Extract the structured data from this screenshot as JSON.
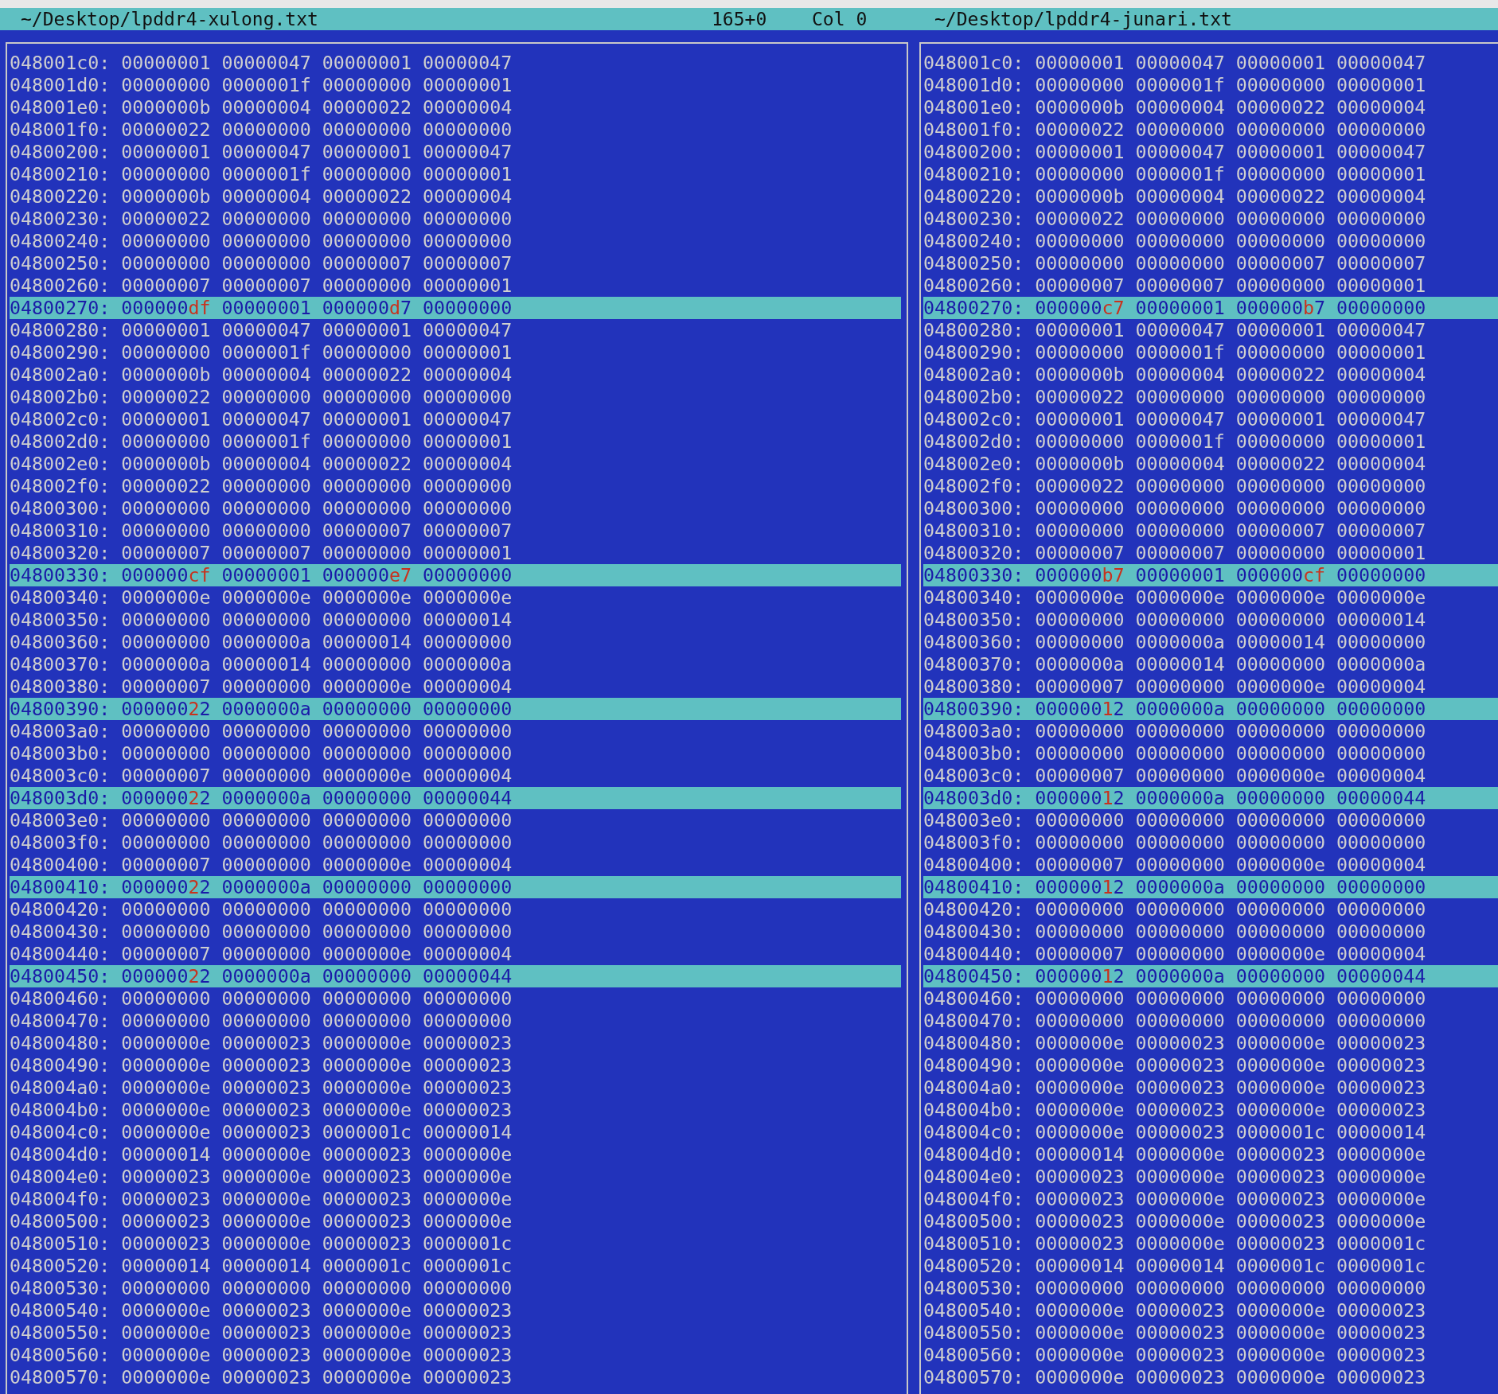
{
  "title_bar": {
    "left_file": "~/Desktop/lpddr4-xulong.txt",
    "position": "165+0",
    "column": "Col 0",
    "right_file": "~/Desktop/lpddr4-junari.txt"
  },
  "panels": [
    {
      "rows": [
        {
          "addr": "048001c0:",
          "words": [
            "00000001",
            "00000047",
            "00000001",
            "00000047"
          ],
          "highlighted": false
        },
        {
          "addr": "048001d0:",
          "words": [
            "00000000",
            "0000001f",
            "00000000",
            "00000001"
          ],
          "highlighted": false
        },
        {
          "addr": "048001e0:",
          "words": [
            "0000000b",
            "00000004",
            "00000022",
            "00000004"
          ],
          "highlighted": false
        },
        {
          "addr": "048001f0:",
          "words": [
            "00000022",
            "00000000",
            "00000000",
            "00000000"
          ],
          "highlighted": false
        },
        {
          "addr": "04800200:",
          "words": [
            "00000001",
            "00000047",
            "00000001",
            "00000047"
          ],
          "highlighted": false
        },
        {
          "addr": "04800210:",
          "words": [
            "00000000",
            "0000001f",
            "00000000",
            "00000001"
          ],
          "highlighted": false
        },
        {
          "addr": "04800220:",
          "words": [
            "0000000b",
            "00000004",
            "00000022",
            "00000004"
          ],
          "highlighted": false
        },
        {
          "addr": "04800230:",
          "words": [
            "00000022",
            "00000000",
            "00000000",
            "00000000"
          ],
          "highlighted": false
        },
        {
          "addr": "04800240:",
          "words": [
            "00000000",
            "00000000",
            "00000000",
            "00000000"
          ],
          "highlighted": false
        },
        {
          "addr": "04800250:",
          "words": [
            "00000000",
            "00000000",
            "00000007",
            "00000007"
          ],
          "highlighted": false
        },
        {
          "addr": "04800260:",
          "words": [
            "00000007",
            "00000007",
            "00000000",
            "00000001"
          ],
          "highlighted": false
        },
        {
          "addr": "04800270:",
          "words": [
            {
              "same": "000000",
              "diff": "df"
            },
            "00000001",
            {
              "same": "000000",
              "diff": "d",
              "rest": "7"
            },
            "00000000"
          ],
          "highlighted": true
        },
        {
          "addr": "04800280:",
          "words": [
            "00000001",
            "00000047",
            "00000001",
            "00000047"
          ],
          "highlighted": false
        },
        {
          "addr": "04800290:",
          "words": [
            "00000000",
            "0000001f",
            "00000000",
            "00000001"
          ],
          "highlighted": false
        },
        {
          "addr": "048002a0:",
          "words": [
            "0000000b",
            "00000004",
            "00000022",
            "00000004"
          ],
          "highlighted": false
        },
        {
          "addr": "048002b0:",
          "words": [
            "00000022",
            "00000000",
            "00000000",
            "00000000"
          ],
          "highlighted": false
        },
        {
          "addr": "048002c0:",
          "words": [
            "00000001",
            "00000047",
            "00000001",
            "00000047"
          ],
          "highlighted": false
        },
        {
          "addr": "048002d0:",
          "words": [
            "00000000",
            "0000001f",
            "00000000",
            "00000001"
          ],
          "highlighted": false
        },
        {
          "addr": "048002e0:",
          "words": [
            "0000000b",
            "00000004",
            "00000022",
            "00000004"
          ],
          "highlighted": false
        },
        {
          "addr": "048002f0:",
          "words": [
            "00000022",
            "00000000",
            "00000000",
            "00000000"
          ],
          "highlighted": false
        },
        {
          "addr": "04800300:",
          "words": [
            "00000000",
            "00000000",
            "00000000",
            "00000000"
          ],
          "highlighted": false
        },
        {
          "addr": "04800310:",
          "words": [
            "00000000",
            "00000000",
            "00000007",
            "00000007"
          ],
          "highlighted": false
        },
        {
          "addr": "04800320:",
          "words": [
            "00000007",
            "00000007",
            "00000000",
            "00000001"
          ],
          "highlighted": false
        },
        {
          "addr": "04800330:",
          "words": [
            {
              "same": "000000",
              "diff": "cf"
            },
            "00000001",
            {
              "same": "000000",
              "diff": "e7"
            },
            "00000000"
          ],
          "highlighted": true
        },
        {
          "addr": "04800340:",
          "words": [
            "0000000e",
            "0000000e",
            "0000000e",
            "0000000e"
          ],
          "highlighted": false
        },
        {
          "addr": "04800350:",
          "words": [
            "00000000",
            "00000000",
            "00000000",
            "00000014"
          ],
          "highlighted": false
        },
        {
          "addr": "04800360:",
          "words": [
            "00000000",
            "0000000a",
            "00000014",
            "00000000"
          ],
          "highlighted": false
        },
        {
          "addr": "04800370:",
          "words": [
            "0000000a",
            "00000014",
            "00000000",
            "0000000a"
          ],
          "highlighted": false
        },
        {
          "addr": "04800380:",
          "words": [
            "00000007",
            "00000000",
            "0000000e",
            "00000004"
          ],
          "highlighted": false
        },
        {
          "addr": "04800390:",
          "words": [
            {
              "same": "000000",
              "diff": "2",
              "rest": "2"
            },
            "0000000a",
            "00000000",
            "00000000"
          ],
          "highlighted": true
        },
        {
          "addr": "048003a0:",
          "words": [
            "00000000",
            "00000000",
            "00000000",
            "00000000"
          ],
          "highlighted": false
        },
        {
          "addr": "048003b0:",
          "words": [
            "00000000",
            "00000000",
            "00000000",
            "00000000"
          ],
          "highlighted": false
        },
        {
          "addr": "048003c0:",
          "words": [
            "00000007",
            "00000000",
            "0000000e",
            "00000004"
          ],
          "highlighted": false
        },
        {
          "addr": "048003d0:",
          "words": [
            {
              "same": "000000",
              "diff": "2",
              "rest": "2"
            },
            "0000000a",
            "00000000",
            "00000044"
          ],
          "highlighted": true
        },
        {
          "addr": "048003e0:",
          "words": [
            "00000000",
            "00000000",
            "00000000",
            "00000000"
          ],
          "highlighted": false
        },
        {
          "addr": "048003f0:",
          "words": [
            "00000000",
            "00000000",
            "00000000",
            "00000000"
          ],
          "highlighted": false
        },
        {
          "addr": "04800400:",
          "words": [
            "00000007",
            "00000000",
            "0000000e",
            "00000004"
          ],
          "highlighted": false
        },
        {
          "addr": "04800410:",
          "words": [
            {
              "same": "000000",
              "diff": "2",
              "rest": "2"
            },
            "0000000a",
            "00000000",
            "00000000"
          ],
          "highlighted": true
        },
        {
          "addr": "04800420:",
          "words": [
            "00000000",
            "00000000",
            "00000000",
            "00000000"
          ],
          "highlighted": false
        },
        {
          "addr": "04800430:",
          "words": [
            "00000000",
            "00000000",
            "00000000",
            "00000000"
          ],
          "highlighted": false
        },
        {
          "addr": "04800440:",
          "words": [
            "00000007",
            "00000000",
            "0000000e",
            "00000004"
          ],
          "highlighted": false
        },
        {
          "addr": "04800450:",
          "words": [
            {
              "same": "000000",
              "diff": "2",
              "rest": "2"
            },
            "0000000a",
            "00000000",
            "00000044"
          ],
          "highlighted": true
        },
        {
          "addr": "04800460:",
          "words": [
            "00000000",
            "00000000",
            "00000000",
            "00000000"
          ],
          "highlighted": false
        },
        {
          "addr": "04800470:",
          "words": [
            "00000000",
            "00000000",
            "00000000",
            "00000000"
          ],
          "highlighted": false
        },
        {
          "addr": "04800480:",
          "words": [
            "0000000e",
            "00000023",
            "0000000e",
            "00000023"
          ],
          "highlighted": false
        },
        {
          "addr": "04800490:",
          "words": [
            "0000000e",
            "00000023",
            "0000000e",
            "00000023"
          ],
          "highlighted": false
        },
        {
          "addr": "048004a0:",
          "words": [
            "0000000e",
            "00000023",
            "0000000e",
            "00000023"
          ],
          "highlighted": false
        },
        {
          "addr": "048004b0:",
          "words": [
            "0000000e",
            "00000023",
            "0000000e",
            "00000023"
          ],
          "highlighted": false
        },
        {
          "addr": "048004c0:",
          "words": [
            "0000000e",
            "00000023",
            "0000001c",
            "00000014"
          ],
          "highlighted": false
        },
        {
          "addr": "048004d0:",
          "words": [
            "00000014",
            "0000000e",
            "00000023",
            "0000000e"
          ],
          "highlighted": false
        },
        {
          "addr": "048004e0:",
          "words": [
            "00000023",
            "0000000e",
            "00000023",
            "0000000e"
          ],
          "highlighted": false
        },
        {
          "addr": "048004f0:",
          "words": [
            "00000023",
            "0000000e",
            "00000023",
            "0000000e"
          ],
          "highlighted": false
        },
        {
          "addr": "04800500:",
          "words": [
            "00000023",
            "0000000e",
            "00000023",
            "0000000e"
          ],
          "highlighted": false
        },
        {
          "addr": "04800510:",
          "words": [
            "00000023",
            "0000000e",
            "00000023",
            "0000001c"
          ],
          "highlighted": false
        },
        {
          "addr": "04800520:",
          "words": [
            "00000014",
            "00000014",
            "0000001c",
            "0000001c"
          ],
          "highlighted": false
        },
        {
          "addr": "04800530:",
          "words": [
            "00000000",
            "00000000",
            "00000000",
            "00000000"
          ],
          "highlighted": false
        },
        {
          "addr": "04800540:",
          "words": [
            "0000000e",
            "00000023",
            "0000000e",
            "00000023"
          ],
          "highlighted": false
        },
        {
          "addr": "04800550:",
          "words": [
            "0000000e",
            "00000023",
            "0000000e",
            "00000023"
          ],
          "highlighted": false
        },
        {
          "addr": "04800560:",
          "words": [
            "0000000e",
            "00000023",
            "0000000e",
            "00000023"
          ],
          "highlighted": false
        },
        {
          "addr": "04800570:",
          "words": [
            "0000000e",
            "00000023",
            "0000000e",
            "00000023"
          ],
          "highlighted": false
        }
      ]
    },
    {
      "rows": [
        {
          "addr": "048001c0:",
          "words": [
            "00000001",
            "00000047",
            "00000001",
            "00000047"
          ],
          "highlighted": false
        },
        {
          "addr": "048001d0:",
          "words": [
            "00000000",
            "0000001f",
            "00000000",
            "00000001"
          ],
          "highlighted": false
        },
        {
          "addr": "048001e0:",
          "words": [
            "0000000b",
            "00000004",
            "00000022",
            "00000004"
          ],
          "highlighted": false
        },
        {
          "addr": "048001f0:",
          "words": [
            "00000022",
            "00000000",
            "00000000",
            "00000000"
          ],
          "highlighted": false
        },
        {
          "addr": "04800200:",
          "words": [
            "00000001",
            "00000047",
            "00000001",
            "00000047"
          ],
          "highlighted": false
        },
        {
          "addr": "04800210:",
          "words": [
            "00000000",
            "0000001f",
            "00000000",
            "00000001"
          ],
          "highlighted": false
        },
        {
          "addr": "04800220:",
          "words": [
            "0000000b",
            "00000004",
            "00000022",
            "00000004"
          ],
          "highlighted": false
        },
        {
          "addr": "04800230:",
          "words": [
            "00000022",
            "00000000",
            "00000000",
            "00000000"
          ],
          "highlighted": false
        },
        {
          "addr": "04800240:",
          "words": [
            "00000000",
            "00000000",
            "00000000",
            "00000000"
          ],
          "highlighted": false
        },
        {
          "addr": "04800250:",
          "words": [
            "00000000",
            "00000000",
            "00000007",
            "00000007"
          ],
          "highlighted": false
        },
        {
          "addr": "04800260:",
          "words": [
            "00000007",
            "00000007",
            "00000000",
            "00000001"
          ],
          "highlighted": false
        },
        {
          "addr": "04800270:",
          "words": [
            {
              "same": "000000",
              "diff": "c7"
            },
            "00000001",
            {
              "same": "000000",
              "diff": "b",
              "rest": "7"
            },
            "00000000"
          ],
          "highlighted": true
        },
        {
          "addr": "04800280:",
          "words": [
            "00000001",
            "00000047",
            "00000001",
            "00000047"
          ],
          "highlighted": false
        },
        {
          "addr": "04800290:",
          "words": [
            "00000000",
            "0000001f",
            "00000000",
            "00000001"
          ],
          "highlighted": false
        },
        {
          "addr": "048002a0:",
          "words": [
            "0000000b",
            "00000004",
            "00000022",
            "00000004"
          ],
          "highlighted": false
        },
        {
          "addr": "048002b0:",
          "words": [
            "00000022",
            "00000000",
            "00000000",
            "00000000"
          ],
          "highlighted": false
        },
        {
          "addr": "048002c0:",
          "words": [
            "00000001",
            "00000047",
            "00000001",
            "00000047"
          ],
          "highlighted": false
        },
        {
          "addr": "048002d0:",
          "words": [
            "00000000",
            "0000001f",
            "00000000",
            "00000001"
          ],
          "highlighted": false
        },
        {
          "addr": "048002e0:",
          "words": [
            "0000000b",
            "00000004",
            "00000022",
            "00000004"
          ],
          "highlighted": false
        },
        {
          "addr": "048002f0:",
          "words": [
            "00000022",
            "00000000",
            "00000000",
            "00000000"
          ],
          "highlighted": false
        },
        {
          "addr": "04800300:",
          "words": [
            "00000000",
            "00000000",
            "00000000",
            "00000000"
          ],
          "highlighted": false
        },
        {
          "addr": "04800310:",
          "words": [
            "00000000",
            "00000000",
            "00000007",
            "00000007"
          ],
          "highlighted": false
        },
        {
          "addr": "04800320:",
          "words": [
            "00000007",
            "00000007",
            "00000000",
            "00000001"
          ],
          "highlighted": false
        },
        {
          "addr": "04800330:",
          "words": [
            {
              "same": "000000",
              "diff": "b7"
            },
            "00000001",
            {
              "same": "000000",
              "diff": "cf"
            },
            "00000000"
          ],
          "highlighted": true
        },
        {
          "addr": "04800340:",
          "words": [
            "0000000e",
            "0000000e",
            "0000000e",
            "0000000e"
          ],
          "highlighted": false
        },
        {
          "addr": "04800350:",
          "words": [
            "00000000",
            "00000000",
            "00000000",
            "00000014"
          ],
          "highlighted": false
        },
        {
          "addr": "04800360:",
          "words": [
            "00000000",
            "0000000a",
            "00000014",
            "00000000"
          ],
          "highlighted": false
        },
        {
          "addr": "04800370:",
          "words": [
            "0000000a",
            "00000014",
            "00000000",
            "0000000a"
          ],
          "highlighted": false
        },
        {
          "addr": "04800380:",
          "words": [
            "00000007",
            "00000000",
            "0000000e",
            "00000004"
          ],
          "highlighted": false
        },
        {
          "addr": "04800390:",
          "words": [
            {
              "same": "000000",
              "diff": "1",
              "rest": "2"
            },
            "0000000a",
            "00000000",
            "00000000"
          ],
          "highlighted": true
        },
        {
          "addr": "048003a0:",
          "words": [
            "00000000",
            "00000000",
            "00000000",
            "00000000"
          ],
          "highlighted": false
        },
        {
          "addr": "048003b0:",
          "words": [
            "00000000",
            "00000000",
            "00000000",
            "00000000"
          ],
          "highlighted": false
        },
        {
          "addr": "048003c0:",
          "words": [
            "00000007",
            "00000000",
            "0000000e",
            "00000004"
          ],
          "highlighted": false
        },
        {
          "addr": "048003d0:",
          "words": [
            {
              "same": "000000",
              "diff": "1",
              "rest": "2"
            },
            "0000000a",
            "00000000",
            "00000044"
          ],
          "highlighted": true
        },
        {
          "addr": "048003e0:",
          "words": [
            "00000000",
            "00000000",
            "00000000",
            "00000000"
          ],
          "highlighted": false
        },
        {
          "addr": "048003f0:",
          "words": [
            "00000000",
            "00000000",
            "00000000",
            "00000000"
          ],
          "highlighted": false
        },
        {
          "addr": "04800400:",
          "words": [
            "00000007",
            "00000000",
            "0000000e",
            "00000004"
          ],
          "highlighted": false
        },
        {
          "addr": "04800410:",
          "words": [
            {
              "same": "000000",
              "diff": "1",
              "rest": "2"
            },
            "0000000a",
            "00000000",
            "00000000"
          ],
          "highlighted": true
        },
        {
          "addr": "04800420:",
          "words": [
            "00000000",
            "00000000",
            "00000000",
            "00000000"
          ],
          "highlighted": false
        },
        {
          "addr": "04800430:",
          "words": [
            "00000000",
            "00000000",
            "00000000",
            "00000000"
          ],
          "highlighted": false
        },
        {
          "addr": "04800440:",
          "words": [
            "00000007",
            "00000000",
            "0000000e",
            "00000004"
          ],
          "highlighted": false
        },
        {
          "addr": "04800450:",
          "words": [
            {
              "same": "000000",
              "diff": "1",
              "rest": "2"
            },
            "0000000a",
            "00000000",
            "00000044"
          ],
          "highlighted": true
        },
        {
          "addr": "04800460:",
          "words": [
            "00000000",
            "00000000",
            "00000000",
            "00000000"
          ],
          "highlighted": false
        },
        {
          "addr": "04800470:",
          "words": [
            "00000000",
            "00000000",
            "00000000",
            "00000000"
          ],
          "highlighted": false
        },
        {
          "addr": "04800480:",
          "words": [
            "0000000e",
            "00000023",
            "0000000e",
            "00000023"
          ],
          "highlighted": false
        },
        {
          "addr": "04800490:",
          "words": [
            "0000000e",
            "00000023",
            "0000000e",
            "00000023"
          ],
          "highlighted": false
        },
        {
          "addr": "048004a0:",
          "words": [
            "0000000e",
            "00000023",
            "0000000e",
            "00000023"
          ],
          "highlighted": false
        },
        {
          "addr": "048004b0:",
          "words": [
            "0000000e",
            "00000023",
            "0000000e",
            "00000023"
          ],
          "highlighted": false
        },
        {
          "addr": "048004c0:",
          "words": [
            "0000000e",
            "00000023",
            "0000001c",
            "00000014"
          ],
          "highlighted": false
        },
        {
          "addr": "048004d0:",
          "words": [
            "00000014",
            "0000000e",
            "00000023",
            "0000000e"
          ],
          "highlighted": false
        },
        {
          "addr": "048004e0:",
          "words": [
            "00000023",
            "0000000e",
            "00000023",
            "0000000e"
          ],
          "highlighted": false
        },
        {
          "addr": "048004f0:",
          "words": [
            "00000023",
            "0000000e",
            "00000023",
            "0000000e"
          ],
          "highlighted": false
        },
        {
          "addr": "04800500:",
          "words": [
            "00000023",
            "0000000e",
            "00000023",
            "0000000e"
          ],
          "highlighted": false
        },
        {
          "addr": "04800510:",
          "words": [
            "00000023",
            "0000000e",
            "00000023",
            "0000001c"
          ],
          "highlighted": false
        },
        {
          "addr": "04800520:",
          "words": [
            "00000014",
            "00000014",
            "0000001c",
            "0000001c"
          ],
          "highlighted": false
        },
        {
          "addr": "04800530:",
          "words": [
            "00000000",
            "00000000",
            "00000000",
            "00000000"
          ],
          "highlighted": false
        },
        {
          "addr": "04800540:",
          "words": [
            "0000000e",
            "00000023",
            "0000000e",
            "00000023"
          ],
          "highlighted": false
        },
        {
          "addr": "04800550:",
          "words": [
            "0000000e",
            "00000023",
            "0000000e",
            "00000023"
          ],
          "highlighted": false
        },
        {
          "addr": "04800560:",
          "words": [
            "0000000e",
            "00000023",
            "0000000e",
            "00000023"
          ],
          "highlighted": false
        },
        {
          "addr": "04800570:",
          "words": [
            "0000000e",
            "00000023",
            "0000000e",
            "00000023"
          ],
          "highlighted": false
        }
      ]
    }
  ]
}
